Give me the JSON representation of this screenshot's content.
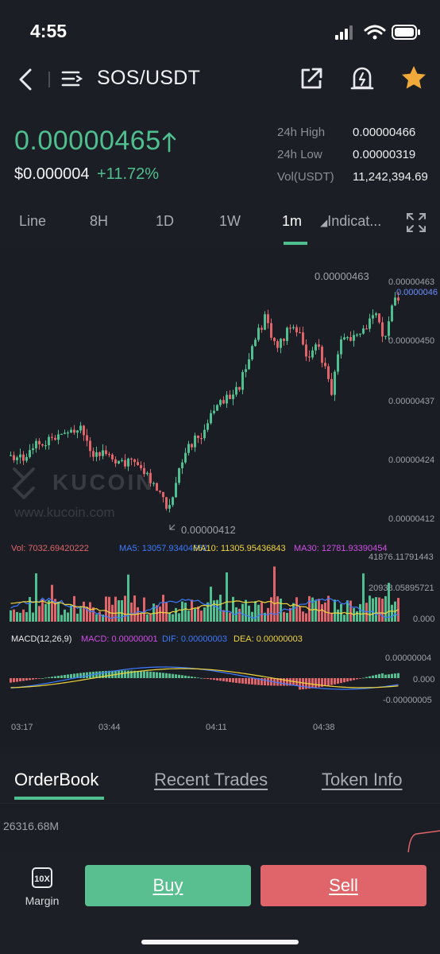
{
  "status_bar": {
    "time": "4:55"
  },
  "header": {
    "pair": "SOS/USDT",
    "icons": [
      "back-icon",
      "menu-icon",
      "share-icon",
      "price-alert-icon",
      "favorite-star-icon"
    ]
  },
  "ticker": {
    "last_price": "0.00000465",
    "usd_price": "$0.000004",
    "change_pct": "+11.72%",
    "high_label": "24h High",
    "high_value": "0.00000466",
    "low_label": "24h Low",
    "low_value": "0.00000319",
    "vol_label": "Vol(USDT)",
    "vol_value": "11,242,394.69"
  },
  "timeframes": {
    "items": [
      "Line",
      "8H",
      "1D",
      "1W",
      "1m"
    ],
    "active": "1m",
    "indicator_label": "Indicat..."
  },
  "chart_texts": {
    "watermark": "KUCOIN",
    "watermark_url": "www.kucoin.com",
    "max_marker": "0.00000463",
    "min_marker": "0.00000412",
    "current_price_tag": "0.0000046",
    "vol_line": "Vol: 7032.69420222",
    "ma5": "MA5: 13057.93404662",
    "ma10": "MA10: 11305.95436843",
    "ma30": "MA30: 12781.93390454",
    "vol_axis_top": "41876.11791443",
    "vol_axis_mid": "20938.05895721",
    "vol_axis_zero": "0.000",
    "macd_params": "MACD(12,26,9)",
    "macd_value": "MACD: 0.00000001",
    "dif_value": "DIF: 0.00000003",
    "dea_value": "DEA: 0.00000003",
    "macd_axis_top": "0.00000004",
    "macd_axis_zero": "0.000",
    "macd_axis_bottom": "-0.00000005"
  },
  "chart_data": {
    "type": "candlestick",
    "price_axis": [
      "0.00000463",
      "0.00000450",
      "0.00000437",
      "0.00000424",
      "0.00000412"
    ],
    "time_axis": [
      "03:17",
      "03:44",
      "04:11",
      "04:38"
    ],
    "price_range": [
      4.05e-06,
      4.7e-06
    ],
    "colors": {
      "up": "#4fbf8f",
      "down": "#e0656a",
      "ma5": "#3d7bff",
      "ma10": "#f0d63c",
      "ma30": "#d04fe8",
      "dif": "#3d7bff",
      "dea": "#f0d63c"
    },
    "grid": false
  },
  "tabs": {
    "items": [
      "OrderBook",
      "Recent Trades",
      "Token Info"
    ],
    "active": "OrderBook"
  },
  "orderbook": {
    "first_amount": "26316.68M"
  },
  "actions": {
    "margin_label": "Margin",
    "margin_icon": "10X",
    "buy": "Buy",
    "sell": "Sell"
  }
}
